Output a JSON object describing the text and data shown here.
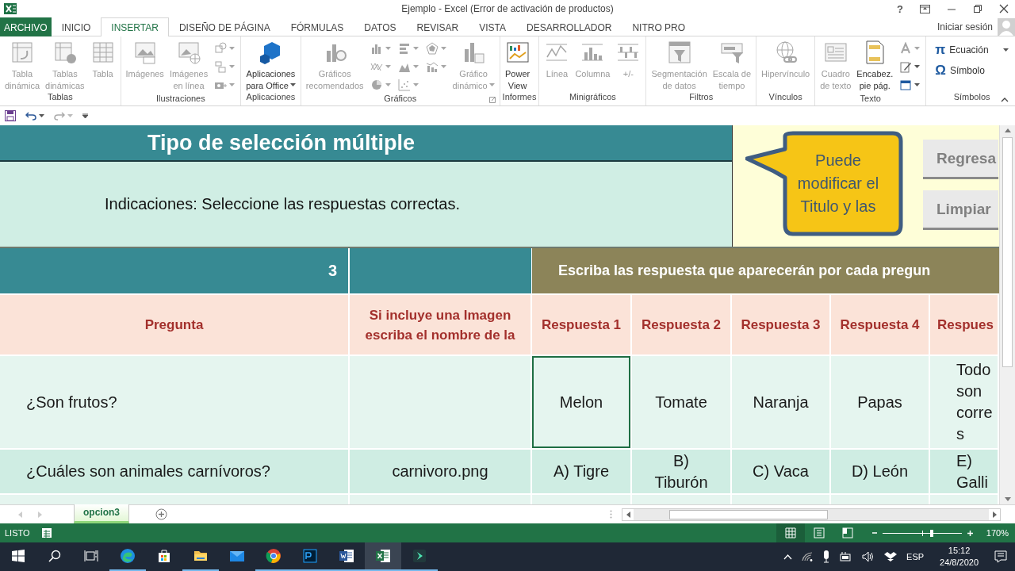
{
  "window": {
    "title": "Ejemplo - Excel (Error de activación de productos)",
    "help": "?"
  },
  "ribbon_tabs": [
    {
      "label": "ARCHIVO",
      "kind": "file",
      "selected": false
    },
    {
      "label": "INICIO",
      "kind": "tab",
      "selected": false
    },
    {
      "label": "INSERTAR",
      "kind": "tab",
      "selected": true
    },
    {
      "label": "DISEÑO DE PÁGINA",
      "kind": "tab",
      "selected": false
    },
    {
      "label": "FÓRMULAS",
      "kind": "tab",
      "selected": false
    },
    {
      "label": "DATOS",
      "kind": "tab",
      "selected": false
    },
    {
      "label": "REVISAR",
      "kind": "tab",
      "selected": false
    },
    {
      "label": "VISTA",
      "kind": "tab",
      "selected": false
    },
    {
      "label": "DESARROLLADOR",
      "kind": "tab",
      "selected": false
    },
    {
      "label": "NITRO PRO",
      "kind": "tab",
      "selected": false
    }
  ],
  "account": {
    "label": "Iniciar sesión"
  },
  "ribbon_groups": [
    {
      "label": "Tablas",
      "commands": [
        {
          "kind": "large",
          "label": "Tabla\ndinámica",
          "disabled": true
        },
        {
          "kind": "large",
          "label": "Tablas\ndinámicas",
          "disabled": true
        },
        {
          "kind": "large",
          "label": "Tabla",
          "disabled": true
        }
      ]
    },
    {
      "label": "Ilustraciones",
      "commands": [
        {
          "kind": "large",
          "label": "Imágenes",
          "disabled": true
        },
        {
          "kind": "large",
          "label": "Imágenes\nen línea",
          "disabled": true
        },
        {
          "kind": "icon",
          "disabled": true
        },
        {
          "kind": "icon",
          "disabled": true
        },
        {
          "kind": "icon",
          "disabled": true
        }
      ]
    },
    {
      "label": "Aplicaciones",
      "commands": [
        {
          "kind": "large",
          "label": "Aplicaciones\npara Office",
          "disabled": false,
          "dropdown": true
        }
      ]
    },
    {
      "label": "Gráficos",
      "launcher": true,
      "commands": [
        {
          "kind": "large",
          "label": "Gráficos\nrecomendados",
          "disabled": true
        },
        {
          "kind": "icon",
          "disabled": true
        },
        {
          "kind": "icon",
          "disabled": true
        },
        {
          "kind": "icon",
          "disabled": true
        },
        {
          "kind": "icon",
          "disabled": true
        },
        {
          "kind": "icon",
          "disabled": true
        },
        {
          "kind": "icon",
          "disabled": true
        },
        {
          "kind": "icon",
          "disabled": true
        },
        {
          "kind": "icon",
          "disabled": true
        },
        {
          "kind": "large",
          "label": "Gráfico\ndinámico",
          "disabled": true,
          "dropdown": true
        }
      ]
    },
    {
      "label": "Informes",
      "commands": [
        {
          "kind": "large",
          "label": "Power\nView",
          "disabled": false
        }
      ]
    },
    {
      "label": "Minigráficos",
      "commands": [
        {
          "kind": "large",
          "label": "Línea",
          "disabled": true
        },
        {
          "kind": "large",
          "label": "Columna",
          "disabled": true
        },
        {
          "kind": "large",
          "label": "+/-",
          "disabled": true
        }
      ]
    },
    {
      "label": "Filtros",
      "commands": [
        {
          "kind": "large",
          "label": "Segmentación\nde datos",
          "disabled": true
        },
        {
          "kind": "large",
          "label": "Escala de\ntiempo",
          "disabled": true
        }
      ]
    },
    {
      "label": "Vínculos",
      "commands": [
        {
          "kind": "large",
          "label": "Hipervínculo",
          "disabled": true
        }
      ]
    },
    {
      "label": "Texto",
      "commands": [
        {
          "kind": "large",
          "label": "Cuadro\nde texto",
          "disabled": true
        },
        {
          "kind": "large",
          "label": "Encabez.\npie pág.",
          "disabled": false
        },
        {
          "kind": "icon",
          "disabled": true
        },
        {
          "kind": "icon",
          "disabled": false
        },
        {
          "kind": "icon",
          "disabled": false
        }
      ]
    },
    {
      "label": "Símbolos",
      "commands": [
        {
          "kind": "small",
          "glyph": "π",
          "label": "Ecuación",
          "disabled": false,
          "dropdown": true
        },
        {
          "kind": "small",
          "glyph": "Ω",
          "label": "Símbolo",
          "disabled": false
        }
      ]
    }
  ],
  "sheet": {
    "title": "Tipo de selección múltiple",
    "instructions": "Indicaciones: Seleccione las respuestas correctas.",
    "callout": "Puede\nmodificar el\nTitulo y las",
    "buttons": [
      "Regresa",
      "Limpiar"
    ],
    "question_number": "3",
    "answers_banner": "Escriba las respuesta que aparecerán por cada pregun",
    "columns": [
      "Pregunta",
      "Si incluye una Imagen\nescriba el nombre de la",
      "Respuesta 1",
      "Respuesta 2",
      "Respuesta 3",
      "Respuesta 4",
      "Respues"
    ],
    "rows": [
      {
        "cells": [
          {
            "text": "¿Son frutos?",
            "selected": false
          },
          {
            "selected": false
          },
          {
            "text": "Melon",
            "selected": true
          },
          {
            "text": "Tomate",
            "selected": false
          },
          {
            "text": "Naranja",
            "selected": false
          },
          {
            "text": "Papas",
            "selected": false
          },
          {
            "text": "Todo\nson\ncorre\ns",
            "selected": false
          }
        ]
      },
      {
        "cells": [
          {
            "text": "¿Cuáles son animales carnívoros?",
            "selected": false
          },
          {
            "text": "carnivoro.png",
            "selected": false
          },
          {
            "text": "A)  Tigre",
            "selected": false
          },
          {
            "text": "B)\nTiburón",
            "selected": false
          },
          {
            "text": "C) Vaca",
            "selected": false
          },
          {
            "text": "D) León",
            "selected": false
          },
          {
            "text": "E)\nGalli",
            "selected": false
          }
        ]
      },
      {
        "cells": [
          {
            "selected": false
          },
          {
            "selected": false
          },
          {
            "selected": false
          },
          {
            "selected": false
          },
          {
            "selected": false
          },
          {
            "selected": false
          },
          {
            "selected": false
          }
        ]
      }
    ]
  },
  "sheet_tabs": [
    {
      "label": "opcion3",
      "selected": true
    }
  ],
  "status_bar": {
    "mode": "LISTO",
    "views": [
      {
        "selected": true
      },
      {
        "selected": false
      },
      {
        "selected": false
      }
    ],
    "zoom": {
      "level": 0.62,
      "reading": "170%"
    }
  },
  "taskbar": {
    "apps": [
      {
        "kind": "edge",
        "running": true,
        "active": false
      },
      {
        "kind": "store",
        "running": false,
        "active": false
      },
      {
        "kind": "folder",
        "running": true,
        "active": false
      },
      {
        "kind": "mail",
        "running": false,
        "active": false
      },
      {
        "kind": "chrome",
        "running": true,
        "active": false
      },
      {
        "kind": "photoshop",
        "running": true,
        "active": false
      },
      {
        "kind": "word",
        "running": true,
        "active": false
      },
      {
        "kind": "excel",
        "running": true,
        "active": true
      },
      {
        "kind": "video",
        "running": true,
        "active": false
      }
    ],
    "language": "ESP",
    "time": "15:12",
    "date": "24/8/2020"
  }
}
